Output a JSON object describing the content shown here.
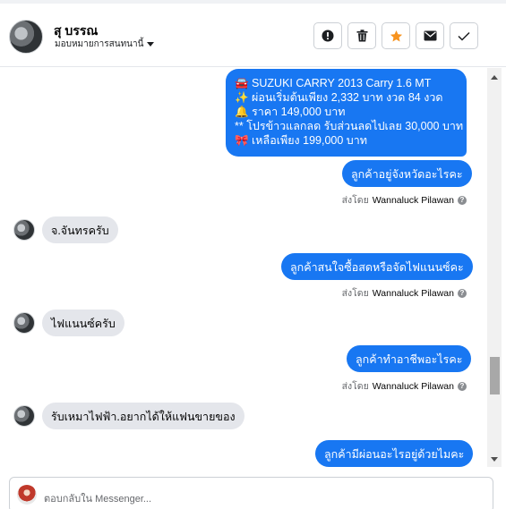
{
  "header": {
    "name": "สุ บรรณ",
    "assign_label": "มอบหมายการสนทนานี้",
    "actions": [
      {
        "icon": "alert-icon",
        "label": "spam"
      },
      {
        "icon": "trash-icon",
        "label": "delete"
      },
      {
        "icon": "star-icon",
        "label": "star",
        "color": "#f7931e"
      },
      {
        "icon": "envelope-icon",
        "label": "mark-unread"
      },
      {
        "icon": "check-icon",
        "label": "done"
      }
    ]
  },
  "messages": {
    "listing": {
      "line1": "🚘 SUZUKI CARRY 2013 Carry 1.6 MT",
      "line2": "✨ ผ่อนเริ่มต้นเพียง 2,332 บาท งวด 84 งวด",
      "line3": "🔔  ราคา 149,000 บาท",
      "line4": "** โปรข้าวแลกลด รับส่วนลดไปเลย 30,000 บาท",
      "line5": "🎀 เหลือเพียง 199,000 บาท"
    },
    "out1": "ลูกค้าอยู่จังหวัดอะไรคะ",
    "in1": "จ.จันทรครับ",
    "out2": "ลูกค้าสนใจซื้อสดหรือจัดไฟแนนซ์คะ",
    "in2": "ไฟแนนซ์ครับ",
    "out3": "ลูกค้าทำอาชีพอะไรคะ",
    "in3": "รับเหมาไฟฟ้า.อยากได้ให้แฟนขายของ",
    "out4": "ลูกค้ามีผ่อนอะไรอยู่ด้วยไมคะ"
  },
  "sent_by": {
    "prefix": "ส่งโดย",
    "agent": "Wannaluck Pilawan",
    "help": "?"
  },
  "composer": {
    "placeholder": "ตอบกลับใน Messenger..."
  },
  "colors": {
    "outgoing_bubble": "#1877f2",
    "incoming_bubble": "#e4e6eb",
    "star": "#f7931e"
  }
}
